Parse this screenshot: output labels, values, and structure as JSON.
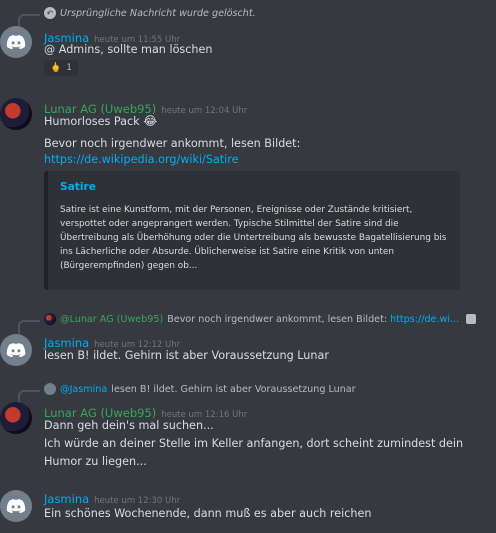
{
  "colors": {
    "jasmina": "#00b0f4",
    "lunar": "#3ba55d",
    "link": "#00b0f4"
  },
  "deleted_notice": "Ursprüngliche Nachricht wurde gelöscht.",
  "messages": [
    {
      "author": "Jasmina",
      "time": "heute um 11:55 Uhr",
      "lines": [
        "@ Admins, sollte man löschen"
      ],
      "reaction": {
        "emoji": "🖕",
        "count": "1"
      }
    },
    {
      "author": "Lunar AG (Uweb95)",
      "time": "heute um 12:04 Uhr",
      "lines": [
        "Humorloses Pack",
        "Bevor noch irgendwer ankommt, lesen Bildet:"
      ],
      "emoji": "😂",
      "link": "https://de.wikipedia.org/wiki/Satire",
      "embed": {
        "title": "Satire",
        "description": "Satire ist eine Kunstform, mit der Personen, Ereignisse oder Zustände kritisiert, verspottet oder angeprangert werden. Typische Stilmittel der Satire sind die Übertreibung als Überhöhung oder die Untertreibung als bewusste Bagatellisierung bis ins Lächerliche oder Absurde. Üblicherweise ist Satire eine Kritik von unten (Bürgerempfinden) gegen ob..."
      }
    },
    {
      "reply_to": {
        "author": "@Lunar AG (Uweb95)",
        "text": "Bevor noch irgendwer ankommt, lesen Bildet:",
        "link": "https://de.wi..."
      },
      "author": "Jasmina",
      "time": "heute um 12:12 Uhr",
      "lines": [
        "lesen B! ildet. Gehirn ist aber Voraussetzung Lunar"
      ]
    },
    {
      "reply_to": {
        "author": "@Jasmina",
        "text": "lesen B! ildet. Gehirn ist aber Voraussetzung Lunar"
      },
      "author": "Lunar AG (Uweb95)",
      "time": "heute um 12:16 Uhr",
      "lines": [
        "Dann geh dein's mal suchen...",
        "Ich würde an deiner Stelle im Keller anfangen, dort scheint zumindest dein",
        "Humor zu liegen..."
      ]
    },
    {
      "author": "Jasmina",
      "time": "heute um 12:30 Uhr",
      "lines": [
        "Ein schönes Wochenende, dann muß es aber auch reichen"
      ]
    }
  ]
}
